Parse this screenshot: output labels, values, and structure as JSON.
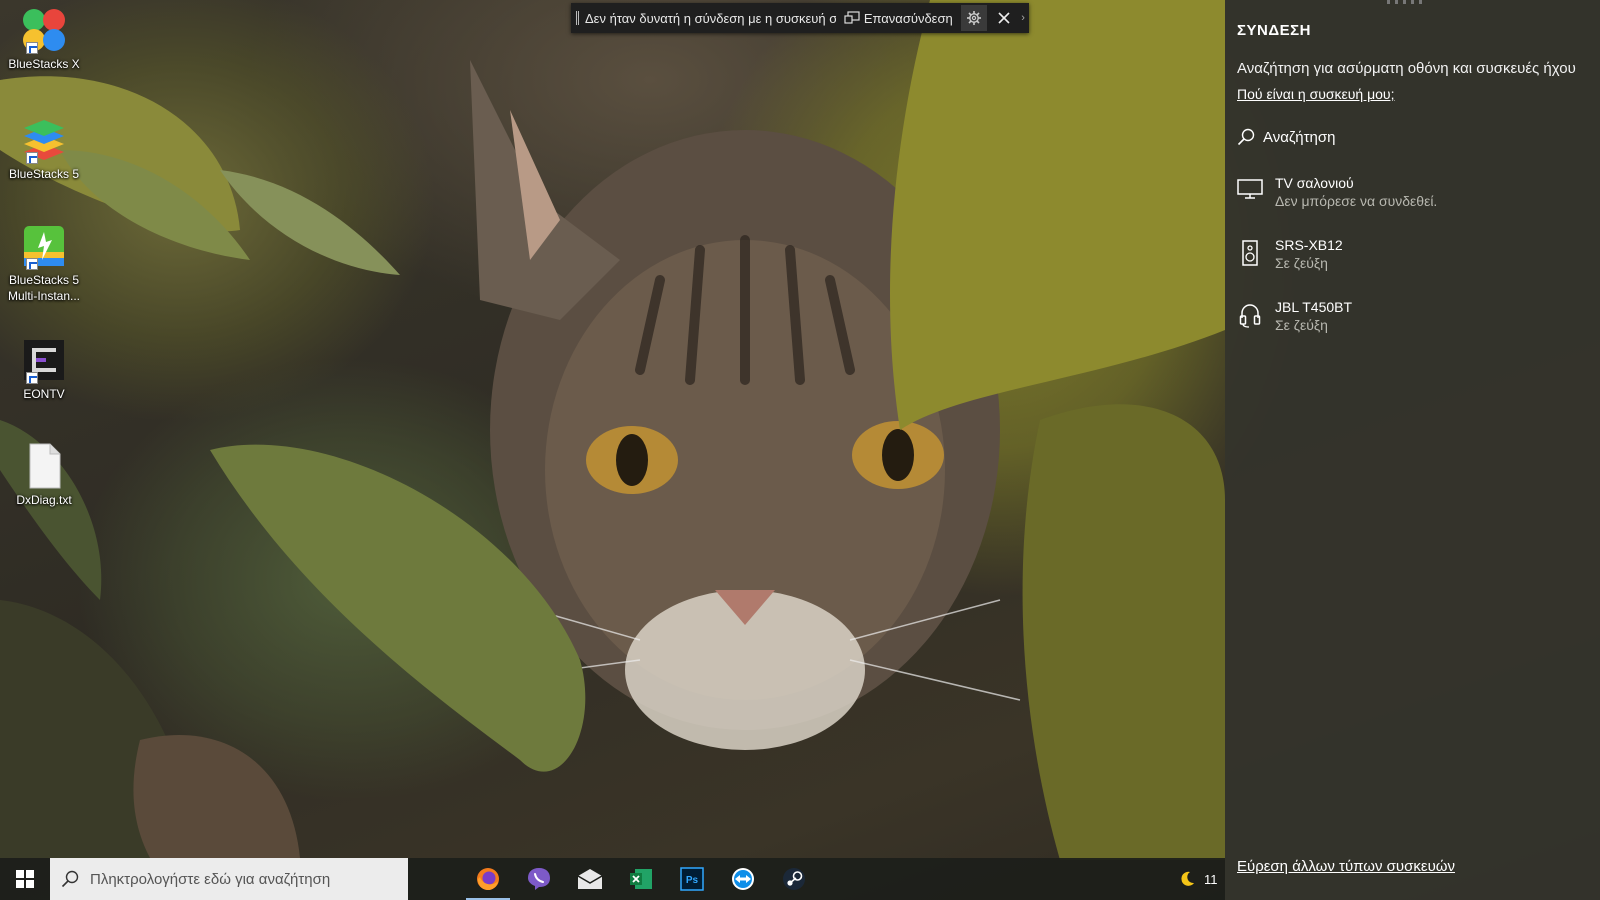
{
  "desktop": {
    "icons": [
      {
        "label": "BlueStacks X",
        "icon": "bluestacks-x-icon"
      },
      {
        "label": "BlueStacks 5",
        "icon": "bluestacks-5-icon"
      },
      {
        "label": "BlueStacks 5 Multi-Instan...",
        "icon": "bluestacks-multi-instance-icon"
      },
      {
        "label": "EONTV",
        "icon": "eontv-icon"
      },
      {
        "label": "DxDiag.txt",
        "icon": "text-file-icon"
      }
    ]
  },
  "cast_bar": {
    "message": "Δεν ήταν δυνατή η σύνδεση με η συσκευή σε",
    "reconnect_label": "Επανασύνδεση"
  },
  "connect_panel": {
    "title": "ΣΥΝΔΕΣΗ",
    "subtitle": "Αναζήτηση για ασύρματη οθόνη και συσκευές ήχου",
    "where_link": "Πού είναι η συσκευή μου;",
    "search_label": "Αναζήτηση",
    "devices": [
      {
        "name": "TV σαλονιού",
        "status": "Δεν μπόρεσε να συνδεθεί.",
        "icon": "monitor-icon"
      },
      {
        "name": "SRS-XB12",
        "status": "Σε ζεύξη",
        "icon": "speaker-icon"
      },
      {
        "name": "JBL T450BT",
        "status": "Σε ζεύξη",
        "icon": "headphones-icon"
      }
    ],
    "other_link": "Εύρεση άλλων τύπων συσκευών"
  },
  "taskbar": {
    "search_placeholder": "Πληκτρολογήστε εδώ για αναζήτηση",
    "apps": [
      "Firefox",
      "Viber",
      "Mail",
      "Excel",
      "Photoshop",
      "TeamViewer",
      "Steam"
    ],
    "tray_time": "11"
  },
  "colors": {
    "panel_bg": "#34342c",
    "taskbar_bg": "#1c1e1a",
    "accent": "#9ac0e8"
  }
}
